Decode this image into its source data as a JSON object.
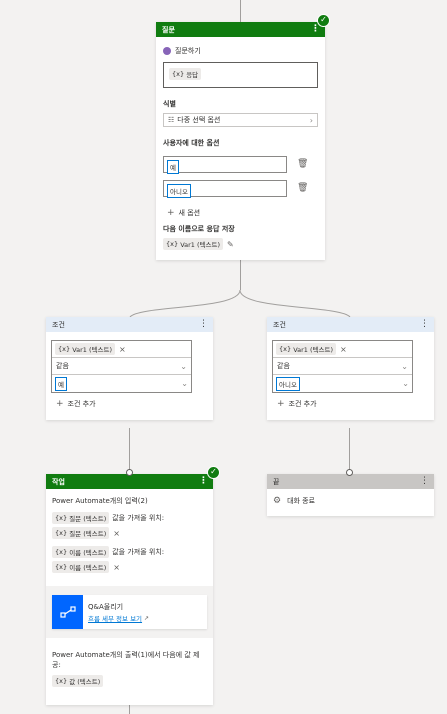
{
  "question_node": {
    "title": "질문",
    "ask_label": "질문하기",
    "prompt_var": "{x}",
    "prompt_text": "응답",
    "identify_label": "식별",
    "identify_value": "다중 선택 옵션",
    "options_label": "사용자에 대한 옵션",
    "options": [
      "예",
      "아니오"
    ],
    "new_option": "새 옵션",
    "save_label": "다음 이름으로 응답 저장",
    "save_var": "Var1 (텍스트)"
  },
  "condition_left": {
    "title": "조건",
    "var_tag": "Var1 (텍스트)",
    "operator": "같음",
    "value": "예",
    "add_label": "조건 추가"
  },
  "condition_right": {
    "title": "조건",
    "var_tag": "Var1 (텍스트)",
    "operator": "같음",
    "value": "아니오",
    "add_label": "조건 추가"
  },
  "action_node": {
    "title": "작업",
    "flow_label": "Power Automate개의 입력(2)",
    "input1_tag": "질문 (텍스트)",
    "input1_suffix": "값을 가져올 위치:",
    "input1_value": "질문 (텍스트)",
    "input2_tag": "이름 (텍스트)",
    "input2_suffix": "값을 가져올 위치:",
    "input2_value": "이름 (텍스트)",
    "flow_name": "Q&A올리기",
    "flow_link": "흐름 세부 정보 보기",
    "output_label": "Power Automate개의 출력(1)에서 다음에 값 제공:",
    "output_value": "값 (텍스트)"
  },
  "end_node": {
    "title": "끝",
    "end_label": "대화 종료"
  },
  "colors": {
    "green": "#107c10",
    "blue_header": "#e3ecf7",
    "gray_header": "#c8c6c4",
    "accent": "#0078d4"
  }
}
